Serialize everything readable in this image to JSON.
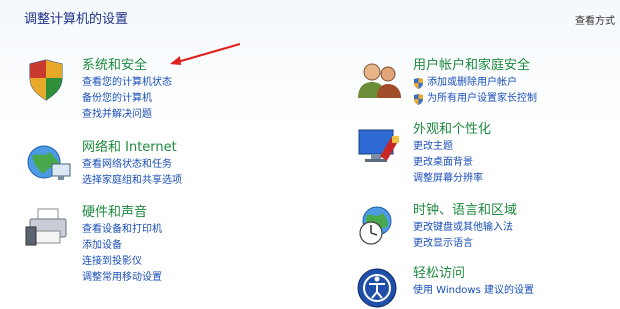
{
  "header": {
    "title": "调整计算机的设置",
    "view_by": "查看方式"
  },
  "categories_left": [
    {
      "title": "系统和安全",
      "icon": "shield-flag-icon",
      "links": [
        "查看您的计算机状态",
        "备份您的计算机",
        "查找并解决问题"
      ]
    },
    {
      "title": "网络和 Internet",
      "icon": "network-globe-icon",
      "links": [
        "查看网络状态和任务",
        "选择家庭组和共享选项"
      ]
    },
    {
      "title": "硬件和声音",
      "icon": "printer-icon",
      "links": [
        "查看设备和打印机",
        "添加设备",
        "连接到投影仪",
        "调整常用移动设置"
      ]
    }
  ],
  "categories_right": [
    {
      "title": "用户帐户和家庭安全",
      "icon": "users-icon",
      "links": [
        "添加或删除用户帐户",
        "为所有用户设置家长控制"
      ]
    },
    {
      "title": "外观和个性化",
      "icon": "monitor-paint-icon",
      "links": [
        "更改主题",
        "更改桌面背景",
        "调整屏幕分辨率"
      ]
    },
    {
      "title": "时钟、语言和区域",
      "icon": "clock-globe-icon",
      "links": [
        "更改键盘或其他输入法",
        "更改显示语言"
      ]
    },
    {
      "title": "轻松访问",
      "icon": "ease-of-access-icon",
      "links": [
        "使用 Windows 建议的设置"
      ]
    }
  ],
  "colors": {
    "title_blue": "#1e3287",
    "category_green": "#1e8a3e",
    "link_blue": "#1a4fb8",
    "arrow_red": "#e0201c"
  }
}
